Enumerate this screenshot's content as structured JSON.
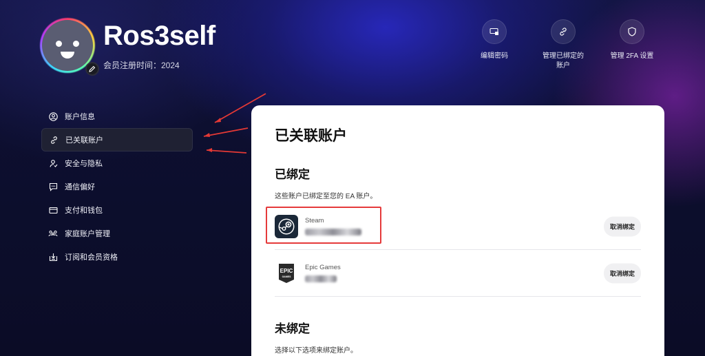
{
  "profile": {
    "username": "Ros3self",
    "member_since": "会员注册时间：2024"
  },
  "quick_actions": [
    {
      "label": "编辑密码",
      "icon": "password-icon"
    },
    {
      "label": "管理已绑定的",
      "label2": "账户",
      "icon": "link-icon"
    },
    {
      "label": "管理 2FA 设置",
      "icon": "shield-icon"
    }
  ],
  "sidebar": {
    "items": [
      {
        "label": "账户信息",
        "icon": "user-circle-icon",
        "active": false
      },
      {
        "label": "已关联账户",
        "icon": "link-icon",
        "active": true
      },
      {
        "label": "安全与隐私",
        "icon": "security-icon",
        "active": false
      },
      {
        "label": "通信偏好",
        "icon": "chat-icon",
        "active": false
      },
      {
        "label": "支付和钱包",
        "icon": "wallet-icon",
        "active": false
      },
      {
        "label": "家庭账户管理",
        "icon": "family-icon",
        "active": false
      },
      {
        "label": "订阅和会员资格",
        "icon": "subscription-icon",
        "active": false
      }
    ]
  },
  "main": {
    "title": "已关联账户",
    "linked_heading": "已绑定",
    "linked_desc": "这些账户已绑定至您的 EA 账户。",
    "linked_accounts": [
      {
        "platform": "Steam",
        "unlink_label": "取消绑定"
      },
      {
        "platform": "Epic Games",
        "unlink_label": "取消绑定"
      }
    ],
    "unlinked_heading": "未绑定",
    "unlinked_desc": "选择以下选项来绑定账户。"
  },
  "colors": {
    "highlight": "#e5393a",
    "accent_bg": "#0d0f2e"
  }
}
